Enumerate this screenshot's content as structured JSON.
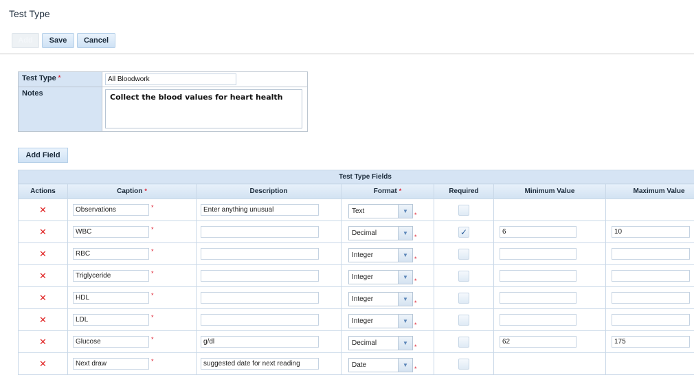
{
  "page": {
    "title": "Test Type"
  },
  "toolbar": {
    "add": "Add",
    "save": "Save",
    "cancel": "Cancel"
  },
  "form": {
    "test_type_label": "Test Type",
    "test_type_value": "All Bloodwork",
    "notes_label": "Notes",
    "notes_value": "Collect the blood values for heart health",
    "required_mark": "*"
  },
  "add_field": "Add Field",
  "grid": {
    "title": "Test Type Fields",
    "columns": {
      "actions": "Actions",
      "caption": "Caption",
      "description": "Description",
      "format": "Format",
      "required": "Required",
      "min": "Minimum Value",
      "max": "Maximum Value"
    },
    "rows": [
      {
        "caption": "Observations",
        "description": "Enter anything unusual",
        "format": "Text",
        "required": false,
        "min": null,
        "max": null
      },
      {
        "caption": "WBC",
        "description": "",
        "format": "Decimal",
        "required": true,
        "min": "6",
        "max": "10"
      },
      {
        "caption": "RBC",
        "description": "",
        "format": "Integer",
        "required": false,
        "min": "",
        "max": ""
      },
      {
        "caption": "Triglyceride",
        "description": "",
        "format": "Integer",
        "required": false,
        "min": "",
        "max": ""
      },
      {
        "caption": "HDL",
        "description": "",
        "format": "Integer",
        "required": false,
        "min": "",
        "max": ""
      },
      {
        "caption": "LDL",
        "description": "",
        "format": "Integer",
        "required": false,
        "min": "",
        "max": ""
      },
      {
        "caption": "Glucose",
        "description": "g/dl",
        "format": "Decimal",
        "required": false,
        "min": "62",
        "max": "175"
      },
      {
        "caption": "Next draw",
        "description": "suggested date for next reading",
        "format": "Date",
        "required": false,
        "min": null,
        "max": null
      }
    ]
  },
  "icons": {
    "delete": "delete-x-icon",
    "dropdown": "chevron-down-icon",
    "check": "checkmark-icon"
  },
  "colors": {
    "header_bg": "#d6e4f4",
    "delete": "#e02424",
    "accent": "#5b86b8"
  }
}
